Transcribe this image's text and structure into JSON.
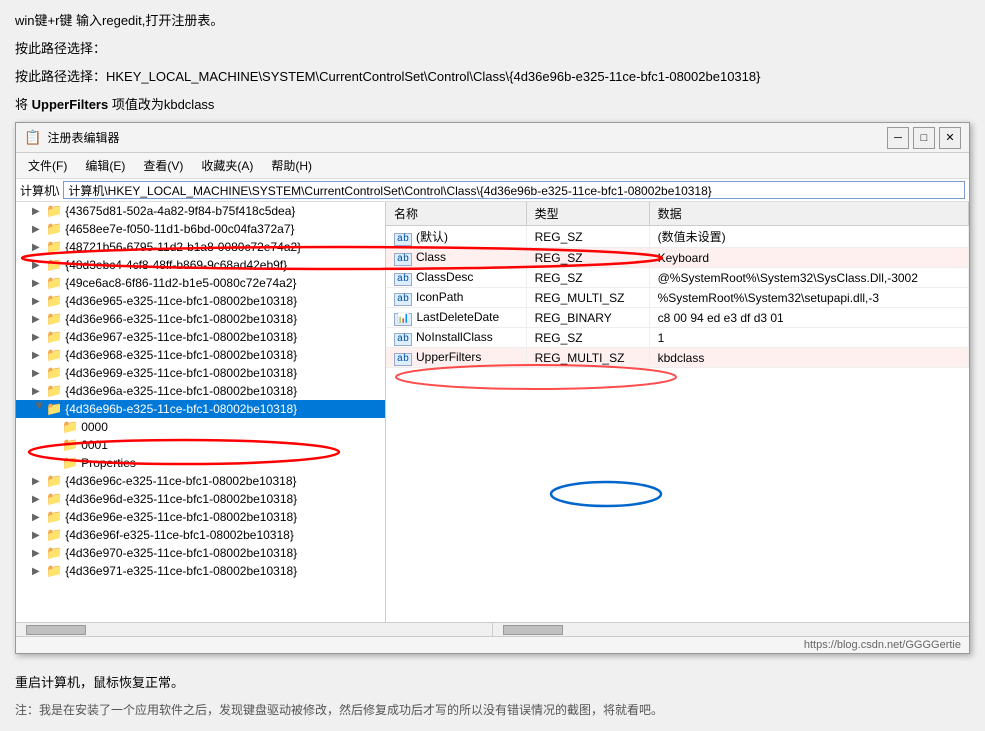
{
  "instructions": {
    "line1": "win键+r键 输入regedit,打开注册表。",
    "line2": "按此路径选择：",
    "line3": "按此路径选择：HKEY_LOCAL_MACHINE\\SYSTEM\\CurrentControlSet\\Control\\Class\\{4d36e96b-e325-11ce-bfc1-08002be10318}",
    "line4_prefix": "将",
    "line4_bold": "UpperFilters",
    "line4_suffix": "项值改为kbdclass"
  },
  "window": {
    "title": "注册表编辑器",
    "icon": "📋"
  },
  "menu": {
    "items": [
      "文件(F)",
      "编辑(E)",
      "查看(V)",
      "收藏夹(A)",
      "帮助(H)"
    ]
  },
  "address": {
    "value": "计算机\\HKEY_LOCAL_MACHINE\\SYSTEM\\CurrentControlSet\\Control\\Class\\{4d36e96b-e325-11ce-bfc1-08002be10318}"
  },
  "tree": {
    "items": [
      {
        "id": "t1",
        "label": "{43675d81-502a-4a82-9f84-b75f418c5dea}",
        "indent": 1,
        "hasArrow": true,
        "expanded": false,
        "selected": false
      },
      {
        "id": "t2",
        "label": "{4658ee7e-f050-11d1-b6bd-00c04fa372a7}",
        "indent": 1,
        "hasArrow": true,
        "expanded": false,
        "selected": false
      },
      {
        "id": "t3",
        "label": "{48721b56-6795-11d2-b1a8-0080c72e74a2}",
        "indent": 1,
        "hasArrow": true,
        "expanded": false,
        "selected": false
      },
      {
        "id": "t4",
        "label": "{48d3ebc4-4cf8-48ff-b869-9c68ad42eb9f}",
        "indent": 1,
        "hasArrow": true,
        "expanded": false,
        "selected": false
      },
      {
        "id": "t5",
        "label": "{49ce6ac8-6f86-11d2-b1e5-0080c72e74a2}",
        "indent": 1,
        "hasArrow": true,
        "expanded": false,
        "selected": false
      },
      {
        "id": "t6",
        "label": "{4d36e965-e325-11ce-bfc1-08002be10318}",
        "indent": 1,
        "hasArrow": true,
        "expanded": false,
        "selected": false
      },
      {
        "id": "t7",
        "label": "{4d36e966-e325-11ce-bfc1-08002be10318}",
        "indent": 1,
        "hasArrow": true,
        "expanded": false,
        "selected": false
      },
      {
        "id": "t8",
        "label": "{4d36e967-e325-11ce-bfc1-08002be10318}",
        "indent": 1,
        "hasArrow": true,
        "expanded": false,
        "selected": false
      },
      {
        "id": "t9",
        "label": "{4d36e968-e325-11ce-bfc1-08002be10318}",
        "indent": 1,
        "hasArrow": true,
        "expanded": false,
        "selected": false
      },
      {
        "id": "t10",
        "label": "{4d36e969-e325-11ce-bfc1-08002be10318}",
        "indent": 1,
        "hasArrow": true,
        "expanded": false,
        "selected": false
      },
      {
        "id": "t11",
        "label": "{4d36e96a-e325-11ce-bfc1-08002be10318}",
        "indent": 1,
        "hasArrow": true,
        "expanded": false,
        "selected": false
      },
      {
        "id": "t12",
        "label": "{4d36e96b-e325-11ce-bfc1-08002be10318}",
        "indent": 1,
        "hasArrow": true,
        "expanded": true,
        "selected": true,
        "circled": true
      },
      {
        "id": "t12a",
        "label": "0000",
        "indent": 2,
        "hasArrow": false,
        "expanded": false,
        "selected": false,
        "isChild": true
      },
      {
        "id": "t12b",
        "label": "0001",
        "indent": 2,
        "hasArrow": false,
        "expanded": false,
        "selected": false,
        "isChild": true
      },
      {
        "id": "t12c",
        "label": "Properties",
        "indent": 2,
        "hasArrow": false,
        "expanded": false,
        "selected": false,
        "isChild": true
      },
      {
        "id": "t13",
        "label": "{4d36e96c-e325-11ce-bfc1-08002be10318}",
        "indent": 1,
        "hasArrow": true,
        "expanded": false,
        "selected": false
      },
      {
        "id": "t14",
        "label": "{4d36e96d-e325-11ce-bfc1-08002be10318}",
        "indent": 1,
        "hasArrow": true,
        "expanded": false,
        "selected": false
      },
      {
        "id": "t15",
        "label": "{4d36e96e-e325-11ce-bfc1-08002be10318}",
        "indent": 1,
        "hasArrow": true,
        "expanded": false,
        "selected": false
      },
      {
        "id": "t16",
        "label": "{4d36e96f-e325-11ce-bfc1-08002be10318}",
        "indent": 1,
        "hasArrow": true,
        "expanded": false,
        "selected": false
      },
      {
        "id": "t17",
        "label": "{4d36e970-e325-11ce-bfc1-08002be10318}",
        "indent": 1,
        "hasArrow": true,
        "expanded": false,
        "selected": false
      },
      {
        "id": "t18",
        "label": "{4d36e971-e325-11ce-bfc1-08002be10318}",
        "indent": 1,
        "hasArrow": true,
        "expanded": false,
        "selected": false
      }
    ]
  },
  "values": {
    "columns": [
      "名称",
      "类型",
      "数据"
    ],
    "rows": [
      {
        "name": "(默认)",
        "type": "REG_SZ",
        "data": "(数值未设置)",
        "icon": "ab"
      },
      {
        "name": "Class",
        "type": "REG_SZ",
        "data": "Keyboard",
        "icon": "ab",
        "highlighted": true
      },
      {
        "name": "ClassDesc",
        "type": "REG_SZ",
        "data": "@%SystemRoot%\\System32\\SysClass.Dll,-3002",
        "icon": "ab"
      },
      {
        "name": "IconPath",
        "type": "REG_MULTI_SZ",
        "data": "%SystemRoot%\\System32\\setupapi.dll,-3",
        "icon": "ab"
      },
      {
        "name": "LastDeleteDate",
        "type": "REG_BINARY",
        "data": "c8 00 94 ed e3 df d3 01",
        "icon": "📊"
      },
      {
        "name": "NoInstallClass",
        "type": "REG_SZ",
        "data": "1",
        "icon": "ab"
      },
      {
        "name": "UpperFilters",
        "type": "REG_MULTI_SZ",
        "data": "kbdclass",
        "icon": "ab",
        "highlighted": true
      }
    ]
  },
  "statusbar": {
    "text": "https://blog.csdn.net/GGGGertie"
  },
  "footer": {
    "line1": "重启计算机，鼠标恢复正常。",
    "line2": "注：我是在安装了一个应用软件之后，发现键盘驱动被修改，然后修复成功后才写的所以没有错误情况的截图，将就看吧。"
  },
  "titlebar": {
    "minimize": "─",
    "maximize": "□",
    "close": "✕"
  }
}
